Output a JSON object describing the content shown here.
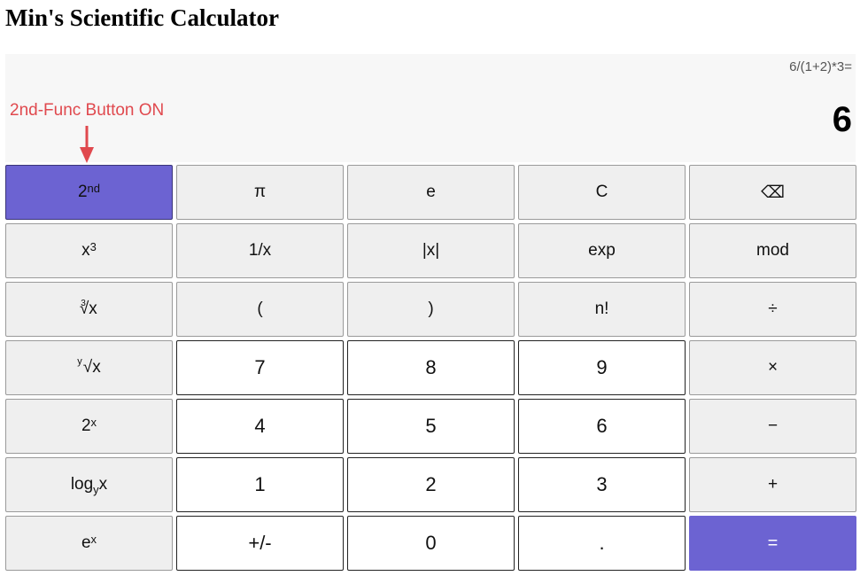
{
  "app": {
    "title": "Min's Scientific Calculator"
  },
  "display": {
    "expression": "6/(1+2)*3=",
    "result": "6"
  },
  "annotation": {
    "text": "2nd-Func Button ON",
    "color": "#e0494e"
  },
  "colors": {
    "accent": "#6c63d2",
    "display_bg": "#f7f7f7",
    "function_key_bg": "#efefef",
    "number_key_bg": "#ffffff"
  },
  "keys": {
    "second": {
      "base": "2",
      "sup": "nd",
      "state": "on"
    },
    "pi": "π",
    "e": "e",
    "clear": "C",
    "backspace": "⌫",
    "cube": {
      "base": "x",
      "sup": "3"
    },
    "reciprocal": "1/x",
    "abs": "|x|",
    "exp": "exp",
    "mod": "mod",
    "cube_root": {
      "index": "3",
      "radical": "√",
      "radicand": "x"
    },
    "open_paren": "(",
    "close_paren": ")",
    "factorial": "n!",
    "divide": "÷",
    "y_root": {
      "index": "y",
      "radical": "√",
      "radicand": "x"
    },
    "seven": "7",
    "eight": "8",
    "nine": "9",
    "multiply": "×",
    "two_pow": {
      "base": "2",
      "sup": "x"
    },
    "four": "4",
    "five": "5",
    "six": "6",
    "minus": "−",
    "log_y": {
      "base": "log",
      "sub": "y",
      "arg": "x"
    },
    "one": "1",
    "two": "2",
    "three": "3",
    "plus": "+",
    "e_pow": {
      "base": "e",
      "sup": "x"
    },
    "negate": "+/-",
    "zero": "0",
    "decimal": ".",
    "equals": "="
  }
}
